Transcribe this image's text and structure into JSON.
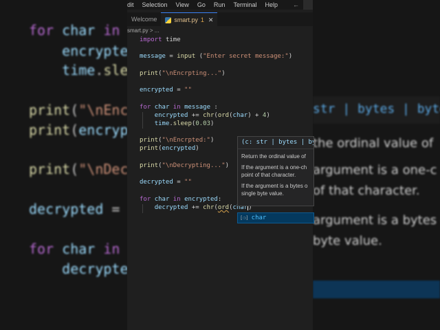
{
  "menu": {
    "items": [
      "dit",
      "Selection",
      "View",
      "Go",
      "Run",
      "Terminal",
      "Help"
    ],
    "back_arrow": "←",
    "forward_arrow": "→"
  },
  "tabs": [
    {
      "label": "Welcome",
      "active": false
    },
    {
      "label": "smart.py",
      "active": true,
      "mark": "1",
      "close": "✕"
    }
  ],
  "breadcrumb": "smart.py > ...",
  "code_lines": [
    "import time",
    "",
    "message = input (\"Enter secret message:\")",
    "",
    "print(\"\\nEncrpting...\")",
    "",
    "encrypted = \"\"",
    "",
    "for char in message :",
    "    encrypted += chr(ord(char) + 4)",
    "    time.sleep(0.03)",
    "",
    "print(\"\\nEncrpted:\")",
    "print(encrypted)",
    "",
    "print(\"\\nDecrypting...\")",
    "",
    "decrypted = \"\"",
    "",
    "for char in encrypted:",
    "    decrypted += chr(ord(char)"
  ],
  "hover": {
    "signature": "(c: str | bytes | byte",
    "description": "Return the ordinal value of",
    "para1_l1": "If the argument is a one-ch",
    "para1_l2": "point of that character.",
    "para2_l1": "If the argument is a bytes o",
    "para2_l2": "single byte value."
  },
  "suggestion": {
    "icon": "[❍]",
    "label": "char"
  },
  "background_left": [
    "for char in m",
    "    encrypted",
    "    time.slee",
    "print(\"\\nEncr",
    "print(encrypt",
    "print(\"\\nDecr",
    "decrypted = ",
    "for char in e",
    "    decrypted"
  ],
  "background_right": {
    "signature": "str | bytes | byte",
    "l1": "the ordinal value of",
    "l2": "argument is a one-c",
    "l3": "of that character.",
    "l4": "argument is a bytes o",
    "l5": "byte value."
  }
}
